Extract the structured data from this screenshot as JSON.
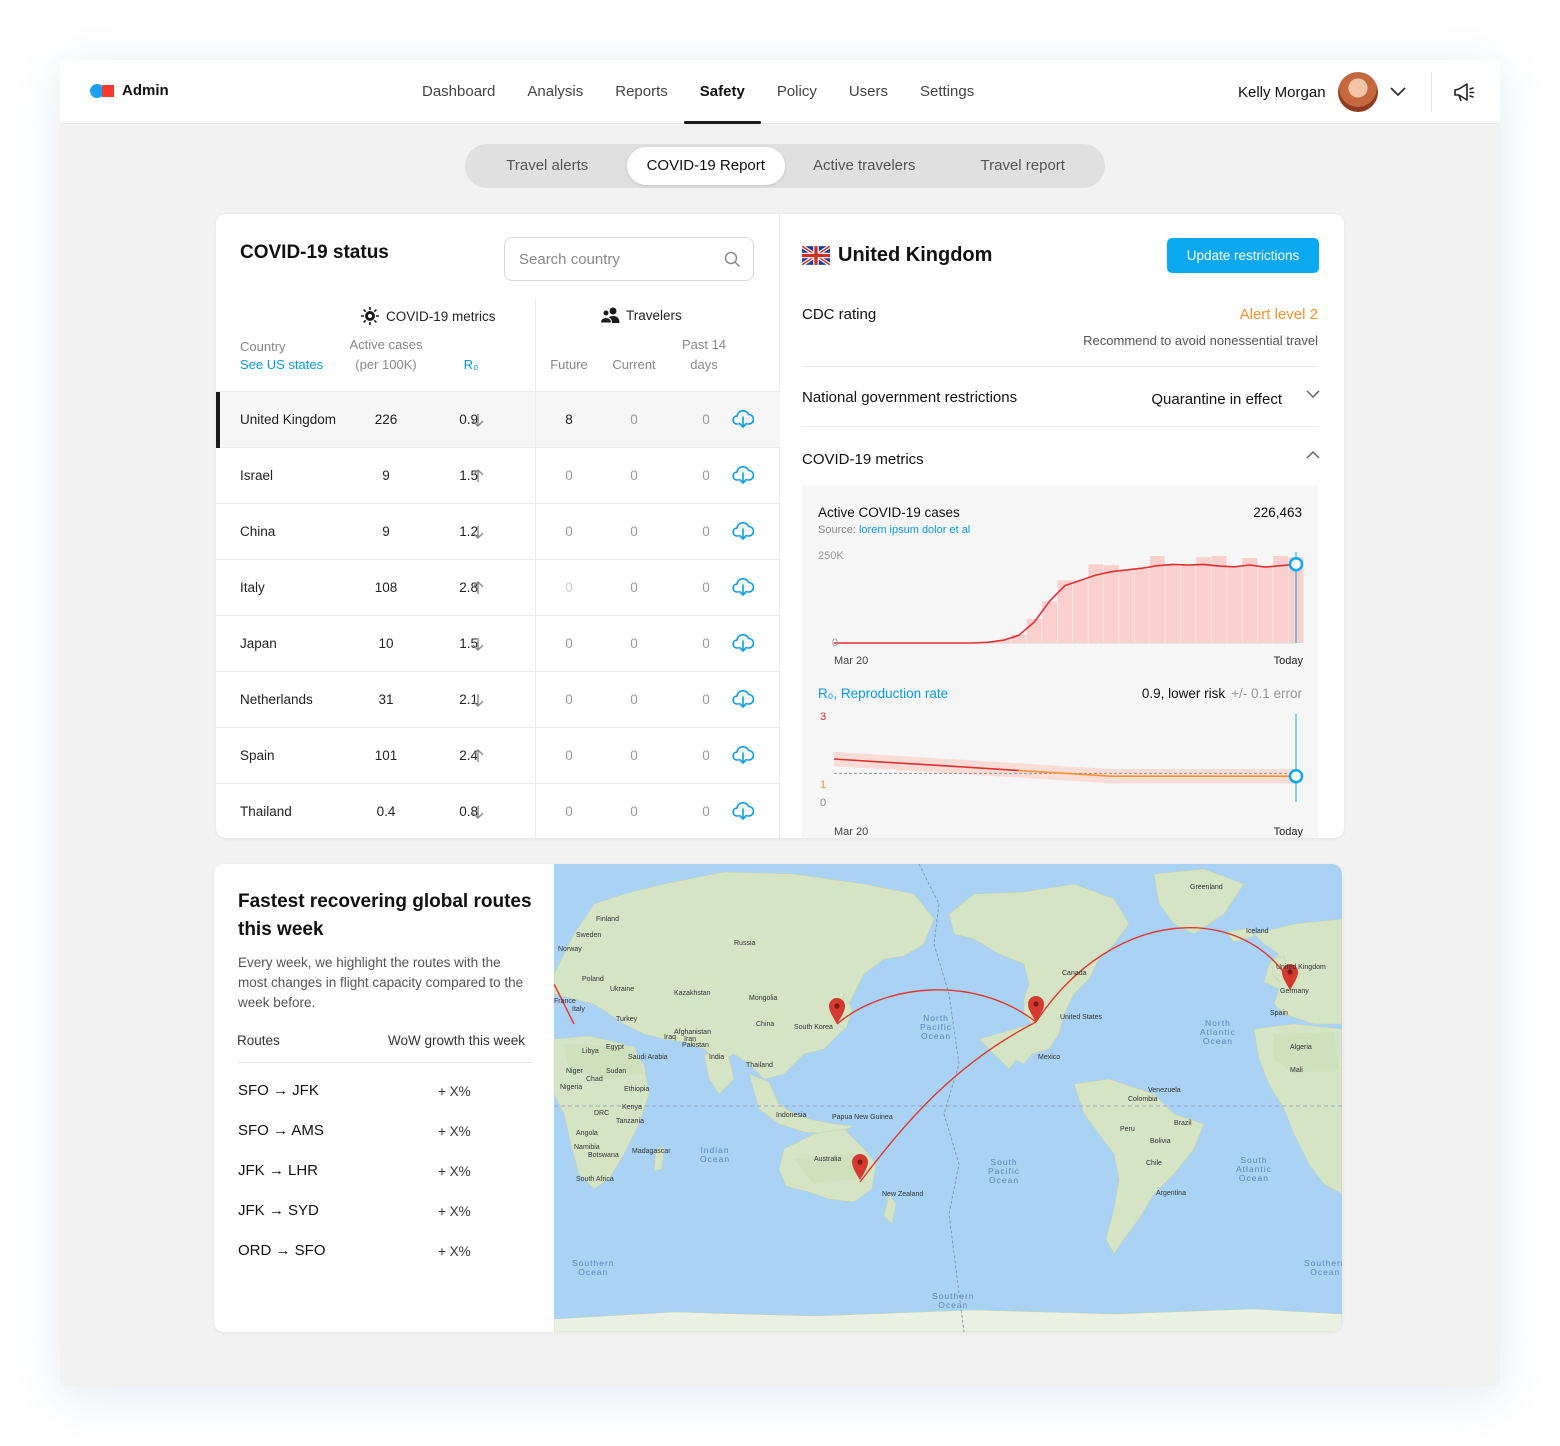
{
  "app": {
    "name": "Admin",
    "colors": {
      "brand_blue": "#1aa0f0",
      "brand_red": "#f53b2e",
      "accent": "#0aa8ef",
      "alert": "#f5922f"
    }
  },
  "nav": {
    "items": [
      "Dashboard",
      "Analysis",
      "Reports",
      "Safety",
      "Policy",
      "Users",
      "Settings"
    ],
    "active": "Safety"
  },
  "user": {
    "name": "Kelly Morgan",
    "menu_icon": "chevron-down-icon",
    "notification_icon": "megaphone-icon"
  },
  "tabs": {
    "items": [
      "Travel alerts",
      "COVID-19 Report",
      "Active travelers",
      "Travel report"
    ],
    "active": "COVID-19 Report"
  },
  "status": {
    "title": "COVID-19 status",
    "search_placeholder": "Search country",
    "groups": {
      "metrics": "COVID-19 metrics",
      "travelers": "Travelers"
    },
    "headers": {
      "country": "Country",
      "us_states_link": "See US states",
      "active_cases_1": "Active cases",
      "active_cases_2": "(per 100K)",
      "r0": "R₀",
      "future": "Future",
      "current": "Current",
      "past_1": "Past 14",
      "past_2": "days"
    },
    "rows": [
      {
        "country": "United Kingdom",
        "cases": "226",
        "r0": "0.9",
        "trend": "down",
        "future": "8",
        "current": "0",
        "past": "0",
        "selected": true
      },
      {
        "country": "Israel",
        "cases": "9",
        "r0": "1.5",
        "trend": "up",
        "future": "0",
        "current": "0",
        "past": "0"
      },
      {
        "country": "China",
        "cases": "9",
        "r0": "1.2",
        "trend": "down",
        "future": "0",
        "current": "0",
        "past": "0"
      },
      {
        "country": "Italy",
        "cases": "108",
        "r0": "2.8",
        "trend": "up",
        "future": "0",
        "current": "0",
        "past": "0"
      },
      {
        "country": "Japan",
        "cases": "10",
        "r0": "1.5",
        "trend": "down",
        "future": "0",
        "current": "0",
        "past": "0"
      },
      {
        "country": "Netherlands",
        "cases": "31",
        "r0": "2.1",
        "trend": "down",
        "future": "0",
        "current": "0",
        "past": "0"
      },
      {
        "country": "Spain",
        "cases": "101",
        "r0": "2.4",
        "trend": "up",
        "future": "0",
        "current": "0",
        "past": "0"
      },
      {
        "country": "Thailand",
        "cases": "0.4",
        "r0": "0.8",
        "trend": "down",
        "future": "0",
        "current": "0",
        "past": "0"
      }
    ]
  },
  "detail": {
    "country": "United Kingdom",
    "update_button": "Update restrictions",
    "cdc_label": "CDC rating",
    "cdc_level": "Alert level 2",
    "cdc_note": "Recommend to avoid nonessential travel",
    "gov_label": "National government restrictions",
    "gov_value": "Quarantine in effect",
    "metrics_label": "COVID-19 metrics"
  },
  "charts": {
    "cases": {
      "title": "Active COVID-19 cases",
      "value": "226,463",
      "source_label": "Source:",
      "source_link": "lorem ipsum dolor et al",
      "y_top": "250K",
      "y_zero": "0",
      "x_start": "Mar 20",
      "x_end": "Today"
    },
    "r0": {
      "title": "R₀, Reproduction rate",
      "value": "0.9, lower risk",
      "error": "+/- 0.1 error",
      "y_top": "3",
      "y_mid": "1",
      "y_zero": "0",
      "x_start": "Mar 20",
      "x_end": "Today"
    }
  },
  "chart_data": [
    {
      "type": "area",
      "title": "Active COVID-19 cases",
      "xlabel": "",
      "ylabel": "",
      "x_range": [
        "Mar 20",
        "Today"
      ],
      "ylim": [
        0,
        250000
      ],
      "series": [
        {
          "values": [
            0,
            0,
            0,
            0,
            0,
            0,
            0,
            0,
            0,
            0,
            2000,
            8000,
            22000,
            60000,
            120000,
            165000,
            180000,
            195000,
            205000,
            210000,
            215000,
            222000,
            226000,
            224000,
            226000,
            221000,
            219000,
            224000,
            218000,
            222000,
            226463
          ]
        }
      ]
    },
    {
      "type": "line",
      "title": "R₀, Reproduction rate",
      "xlabel": "",
      "ylabel": "",
      "x_range": [
        "Mar 20",
        "Today"
      ],
      "ylim": [
        0,
        3
      ],
      "reference_line": 1,
      "series": [
        {
          "values": [
            1.5,
            1.4,
            1.3,
            1.2,
            1.1,
            1.0,
            0.9,
            0.9,
            0.9,
            0.9,
            0.9
          ]
        }
      ]
    }
  ],
  "routes": {
    "title": "Fastest recovering global routes this week",
    "description": "Every week, we highlight the routes with the most changes in flight capacity compared to the week before.",
    "col_routes": "Routes",
    "col_growth": "WoW growth this week",
    "items": [
      {
        "route": "SFO → JFK",
        "growth": "+ X%"
      },
      {
        "route": "SFO → AMS",
        "growth": "+ X%"
      },
      {
        "route": "JFK → LHR",
        "growth": "+ X%"
      },
      {
        "route": "JFK → SYD",
        "growth": "+ X%"
      },
      {
        "route": "ORD → SFO",
        "growth": "+ X%"
      }
    ]
  },
  "map": {
    "labels": [
      "Greenland",
      "Finland",
      "Sweden",
      "Norway",
      "Russia",
      "Poland",
      "Ukraine",
      "France",
      "Italy",
      "Kazakhstan",
      "Mongolia",
      "Turkey",
      "China",
      "South Korea",
      "Iraq",
      "Iran",
      "Afghanistan",
      "Pakistan",
      "India",
      "Egypt",
      "Libya",
      "Saudi Arabia",
      "Sudan",
      "Niger",
      "Chad",
      "Nigeria",
      "Ethiopia",
      "Kenya",
      "Tanzania",
      "DRC",
      "Angola",
      "Namibia",
      "Botswana",
      "South Africa",
      "Madagascar",
      "Thailand",
      "Indonesia",
      "Papua New Guinea",
      "Australia",
      "New Zealand",
      "Canada",
      "United States",
      "Mexico",
      "Venezuela",
      "Colombia",
      "Peru",
      "Brazil",
      "Bolivia",
      "Chile",
      "Argentina",
      "Iceland",
      "United Kingdom",
      "Germany",
      "Spain",
      "Algeria",
      "Mali"
    ],
    "oceans": [
      "North\nPacific\nOcean",
      "North\nAtlantic\nOcean",
      "Indian\nOcean",
      "South\nPacific\nOcean",
      "South\nAtlantic\nOcean",
      "Southern\nOcean"
    ]
  }
}
